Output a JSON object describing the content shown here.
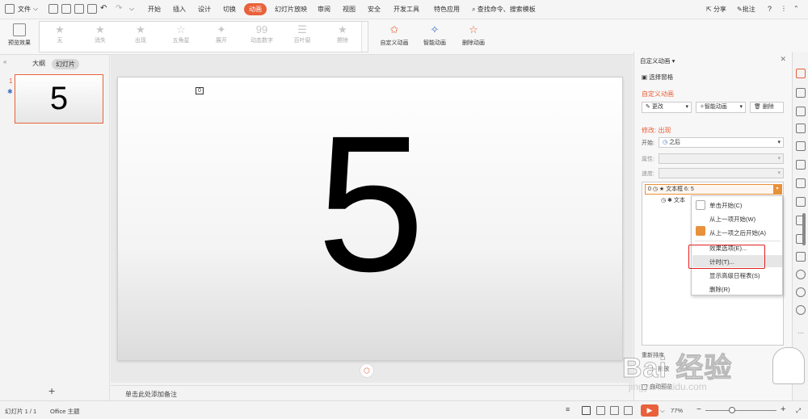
{
  "menubar": {
    "file_label": "文件",
    "items": [
      "开始",
      "插入",
      "设计",
      "切换",
      "动画",
      "幻灯片放映",
      "审阅",
      "视图",
      "安全",
      "开发工具",
      "特色应用"
    ],
    "active_index": 4,
    "search_label": "查找命令、搜索模板",
    "share_label": "分享",
    "comment_label": "批注",
    "help_label": "?"
  },
  "ribbon": {
    "preview_label": "预览效果",
    "gallery": [
      "无",
      "消失",
      "出现",
      "五角星",
      "展开",
      "动态数字",
      "百叶窗",
      "擦除"
    ],
    "custom_anim_label": "自定义动画",
    "smart_anim_label": "智能动画",
    "delete_anim_label": "删除动画"
  },
  "leftpane": {
    "tab_outline": "大纲",
    "tab_slides": "幻灯片",
    "slide_number": "1",
    "thumb_text": "5",
    "add_label": "+"
  },
  "slide": {
    "big_text": "5",
    "tag": "0"
  },
  "notes": {
    "placeholder": "单击此处添加备注"
  },
  "taskpane": {
    "title": "自定义动画 ▾",
    "select_pane": "选择窗格",
    "section_title": "自定义动画",
    "btn_change": "更改",
    "btn_smart": "智能动画",
    "btn_delete": "删除",
    "modify_title": "修改: 出现",
    "start_label": "开始:",
    "start_value": "之后",
    "property_label": "属性:",
    "speed_label": "速度:",
    "item1": "0  ◷  ★  文本框 6: 5",
    "item2": "◷  ✱  文本",
    "reorder_label": "重新排序",
    "play_label": "播放",
    "autopreview_label": "自动预览"
  },
  "context_menu": {
    "items": [
      "单击开始(C)",
      "从上一项开始(W)",
      "从上一项之后开始(A)",
      "效果选项(E)...",
      "计时(T)...",
      "显示高级日程表(S)",
      "删除(R)"
    ],
    "highlighted_index": 4
  },
  "statusbar": {
    "slide_info": "幻灯片 1 / 1",
    "theme": "Office 主题",
    "zoom": "77%",
    "minus": "−",
    "plus": "+"
  },
  "watermark": {
    "text": "Bai 经验",
    "url": "jingyan.baidu.com"
  },
  "colors": {
    "accent": "#e8613b",
    "highlight_box": "#e02020"
  }
}
